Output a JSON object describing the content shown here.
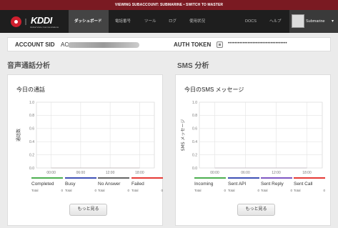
{
  "banner": {
    "text": "VIEWING SUBACCOUNT: SUBMARINE",
    "separator": " • ",
    "link": "SWITCH TO MASTER"
  },
  "nav": {
    "brand": "KDDI",
    "brand_sub": "Global Voice Communications",
    "items": [
      "ダッシュボード",
      "電話番号",
      "ツール",
      "ログ",
      "使用状況"
    ],
    "right_items": [
      "DOCS",
      "ヘルプ"
    ],
    "account_name": "Submarine"
  },
  "ids": {
    "sid_label": "ACCOUNT SID",
    "sid_prefix": "AC",
    "token_label": "AUTH TOKEN",
    "token_mask": "••••••••••••••••••••••••••••••••••••"
  },
  "sections": {
    "voice": "音声通話分析",
    "sms": "SMS 分析"
  },
  "panels": [
    {
      "title": "今日の通話",
      "ylabel": "通話数",
      "yticks": [
        "1.0",
        "0.8",
        "0.6",
        "0.4",
        "0.2",
        "0.0"
      ],
      "xticks": [
        "00:00",
        "06:00",
        "12:00",
        "18:00"
      ],
      "legend": [
        {
          "name": "Completed",
          "total_label": "Total",
          "total": "0",
          "color": "#4caf50"
        },
        {
          "name": "Busy",
          "total_label": "Total",
          "total": "0",
          "color": "#3f51b5"
        },
        {
          "name": "No Answer",
          "total_label": "Total",
          "total": "0",
          "color": "#666666"
        },
        {
          "name": "Failed",
          "total_label": "Total",
          "total": "0",
          "color": "#e53935"
        }
      ],
      "more_label": "もっと見る"
    },
    {
      "title": "今日のSMS メッセージ",
      "ylabel": "SMS メッセージ",
      "yticks": [
        "1.0",
        "0.8",
        "0.6",
        "0.4",
        "0.2",
        "0.0"
      ],
      "xticks": [
        "00:00",
        "06:00",
        "12:00",
        "18:00"
      ],
      "legend": [
        {
          "name": "Incoming",
          "total_label": "Total",
          "total": "0",
          "color": "#4caf50"
        },
        {
          "name": "Sent API",
          "total_label": "Total",
          "total": "0",
          "color": "#3f51b5"
        },
        {
          "name": "Sent Reply",
          "total_label": "Total",
          "total": "0",
          "color": "#7e57c2"
        },
        {
          "name": "Sent Call",
          "total_label": "Total",
          "total": "0",
          "color": "#e53935"
        }
      ],
      "more_label": "もっと見る"
    }
  ],
  "chart_data": [
    {
      "type": "line",
      "title": "今日の通話",
      "ylabel": "通話数",
      "xlabel": "",
      "ylim": [
        0,
        1
      ],
      "categories": [
        "00:00",
        "06:00",
        "12:00",
        "18:00"
      ],
      "series": [
        {
          "name": "Completed",
          "values": [
            0,
            0,
            0,
            0
          ]
        },
        {
          "name": "Busy",
          "values": [
            0,
            0,
            0,
            0
          ]
        },
        {
          "name": "No Answer",
          "values": [
            0,
            0,
            0,
            0
          ]
        },
        {
          "name": "Failed",
          "values": [
            0,
            0,
            0,
            0
          ]
        }
      ],
      "grid": true
    },
    {
      "type": "line",
      "title": "今日のSMS メッセージ",
      "ylabel": "SMS メッセージ",
      "xlabel": "",
      "ylim": [
        0,
        1
      ],
      "categories": [
        "00:00",
        "06:00",
        "12:00",
        "18:00"
      ],
      "series": [
        {
          "name": "Incoming",
          "values": [
            0,
            0,
            0,
            0
          ]
        },
        {
          "name": "Sent API",
          "values": [
            0,
            0,
            0,
            0
          ]
        },
        {
          "name": "Sent Reply",
          "values": [
            0,
            0,
            0,
            0
          ]
        },
        {
          "name": "Sent Call",
          "values": [
            0,
            0,
            0,
            0
          ]
        }
      ],
      "grid": true
    }
  ]
}
